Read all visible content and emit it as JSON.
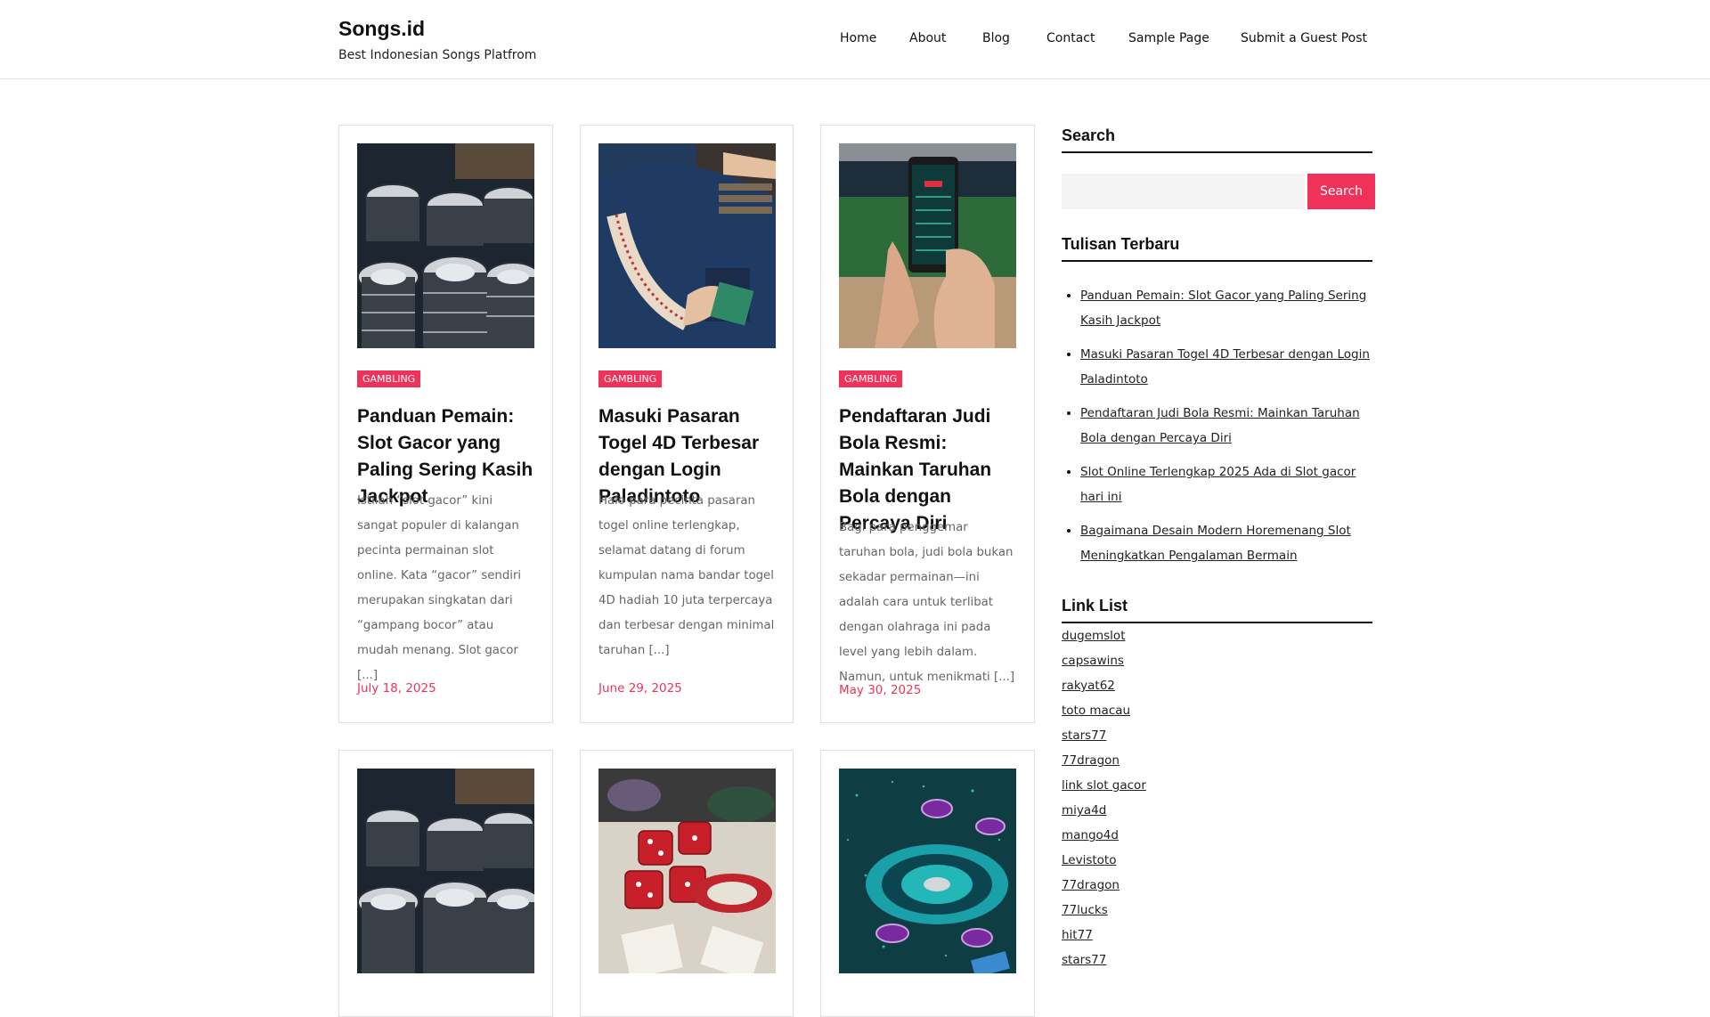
{
  "site": {
    "title": "Songs.id",
    "tagline": "Best Indonesian Songs Platfrom"
  },
  "nav": {
    "items": [
      "Home",
      "About",
      "Blog",
      "Contact",
      "Sample Page",
      "Submit a Guest Post"
    ]
  },
  "posts": [
    {
      "image": "casino-chips-stacks",
      "category": "GAMBLING",
      "title": "Panduan Pemain: Slot Gacor yang Paling Sering Kasih Jackpot",
      "excerpt": "Istilah “slot gacor” kini sangat populer di kalangan pecinta permainan slot online. Kata “gacor” sendiri merupakan singkatan dari “gampang bocor” atau mudah menang. Slot gacor [...]",
      "date": "July 18, 2025"
    },
    {
      "image": "card-dealer-table",
      "category": "GAMBLING",
      "title": "Masuki Pasaran Togel 4D Terbesar dengan Login Paladintoto",
      "excerpt": "Halo para pecinta pasaran togel online terlengkap, selamat datang di forum kumpulan nama bandar togel 4D hadiah 10 juta terpercaya dan terbesar dengan minimal taruhan [...]",
      "date": "June 29, 2025"
    },
    {
      "image": "phone-live-betting",
      "category": "GAMBLING",
      "title": "Pendaftaran Judi Bola Resmi: Mainkan Taruhan Bola dengan Percaya Diri",
      "excerpt": "Bagi para penggemar taruhan bola, judi bola bukan sekadar permainan—ini adalah cara untuk terlibat dengan olahraga ini pada level yang lebih dalam. Namun, untuk menikmati [...]",
      "date": "May 30, 2025"
    },
    {
      "image": "casino-chips-stacks"
    },
    {
      "image": "red-dice-chips"
    },
    {
      "image": "roulette-wheel-teal"
    }
  ],
  "sidebar": {
    "search": {
      "title": "Search",
      "placeholder": "",
      "button": "Search"
    },
    "recent": {
      "title": "Tulisan Terbaru",
      "items": [
        "Panduan Pemain: Slot Gacor yang Paling Sering Kasih Jackpot",
        "Masuki Pasaran Togel 4D Terbesar dengan Login Paladintoto",
        "Pendaftaran Judi Bola Resmi: Mainkan Taruhan Bola dengan Percaya Diri",
        "Slot Online Terlengkap 2025 Ada di Slot gacor hari ini",
        "Bagaimana Desain Modern Horemenang Slot Meningkatkan Pengalaman Bermain"
      ]
    },
    "links": {
      "title": "Link List",
      "items": [
        "dugemslot",
        "capsawins",
        "rakyat62",
        "toto macau",
        "stars77",
        "77dragon",
        "link slot gacor",
        "miya4d",
        "mango4d",
        "Levistoto",
        "77dragon",
        "77lucks",
        "hit77",
        "stars77"
      ]
    }
  },
  "colors": {
    "accent": "#f0325a",
    "text": "#111111",
    "muted": "#666666",
    "border": "#e0e0e0"
  }
}
